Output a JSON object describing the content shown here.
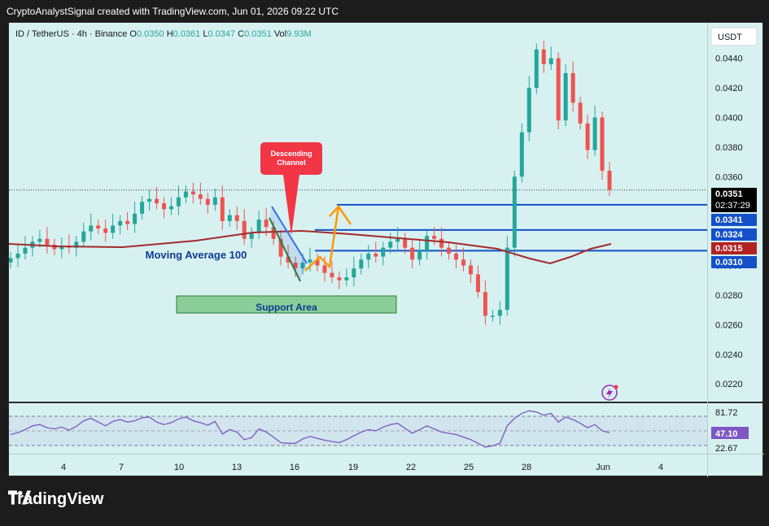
{
  "header": {
    "created_line": "CryptoAnalystSignal created with TradingView.com, Jun 01, 2026 09:22 UTC"
  },
  "symbol": {
    "pair": "ID / TetherUS · 4h · Binance",
    "o_label": "O",
    "o": "0.0350",
    "h_label": "H",
    "h": "0.0361",
    "l_label": "L",
    "l": "0.0347",
    "c_label": "C",
    "c": "0.0351",
    "vol_label": "Vol",
    "vol": "9.93M"
  },
  "currency": "USDT",
  "annotations": {
    "descending_channel": [
      "Descending",
      "Channel"
    ],
    "moving_average": "Moving Average 100",
    "support_area": "Support Area"
  },
  "price_badges": [
    {
      "label": "0.0351",
      "sub": "02:37:29",
      "bg": "#000000"
    },
    {
      "label": "0.0341",
      "bg": "#1450c8"
    },
    {
      "label": "0.0324",
      "bg": "#1450c8"
    },
    {
      "label": "0.0315",
      "bg": "#b22222"
    },
    {
      "label": "0.0310",
      "bg": "#1450c8"
    }
  ],
  "rsi": {
    "upper": "81.72",
    "value": "47.10",
    "lower": "22.67",
    "value_color": "#7e57c2"
  },
  "footer": {
    "brand": "TradingView"
  },
  "colors": {
    "up": "#26a69a",
    "down": "#ef5350",
    "ma": "#a52a2a",
    "level": "#1450c8",
    "bg": "#d7f1f1"
  },
  "chart_data": {
    "type": "candlestick",
    "title": "ID / TetherUS · 4h · Binance",
    "y_ticks": [
      "0.0440",
      "0.0420",
      "0.0400",
      "0.0380",
      "0.0360",
      "0.0340",
      "0.0320",
      "0.0300",
      "0.0280",
      "0.0260",
      "0.0240",
      "0.0220"
    ],
    "x_ticks": [
      "4",
      "7",
      "10",
      "13",
      "16",
      "19",
      "22",
      "25",
      "28",
      "Jun",
      "4"
    ],
    "ylim": [
      0.0208,
      0.0464
    ],
    "levels": [
      0.0341,
      0.0324,
      0.031
    ],
    "last_price": 0.0351,
    "ma100_last": 0.0315,
    "closes": [
      0.0305,
      0.0308,
      0.0312,
      0.0316,
      0.0318,
      0.0314,
      0.0311,
      0.0313,
      0.0312,
      0.0316,
      0.0323,
      0.0327,
      0.0325,
      0.0322,
      0.0327,
      0.033,
      0.0328,
      0.0335,
      0.0343,
      0.0345,
      0.0342,
      0.0338,
      0.034,
      0.0346,
      0.035,
      0.0348,
      0.0345,
      0.0341,
      0.0346,
      0.033,
      0.0334,
      0.033,
      0.0318,
      0.0322,
      0.0331,
      0.0326,
      0.0318,
      0.0306,
      0.0302,
      0.0298,
      0.0302,
      0.0304,
      0.03,
      0.0295,
      0.0292,
      0.029,
      0.0292,
      0.0298,
      0.0304,
      0.0308,
      0.0306,
      0.0312,
      0.0316,
      0.0318,
      0.0312,
      0.0304,
      0.031,
      0.032,
      0.0318,
      0.0312,
      0.0308,
      0.0304,
      0.03,
      0.0294,
      0.0282,
      0.0266,
      0.0266,
      0.027,
      0.0312,
      0.036,
      0.039,
      0.042,
      0.0446,
      0.0436,
      0.044,
      0.0398,
      0.043,
      0.041,
      0.0396,
      0.0378,
      0.04,
      0.0364,
      0.0351
    ],
    "rsi_values": [
      44,
      47,
      52,
      58,
      60,
      55,
      53,
      56,
      51,
      57,
      66,
      70,
      64,
      58,
      65,
      68,
      64,
      66,
      71,
      72,
      64,
      60,
      63,
      69,
      72,
      66,
      63,
      59,
      65,
      45,
      52,
      48,
      36,
      39,
      53,
      48,
      40,
      31,
      30,
      30,
      37,
      41,
      38,
      35,
      33,
      31,
      36,
      42,
      48,
      52,
      50,
      56,
      60,
      62,
      54,
      46,
      52,
      58,
      53,
      48,
      46,
      44,
      40,
      36,
      30,
      24,
      26,
      30,
      58,
      70,
      78,
      82,
      80,
      75,
      78,
      64,
      72,
      68,
      62,
      55,
      60,
      50,
      47
    ],
    "rsi_levels": [
      81.72,
      47.1,
      22.67
    ]
  }
}
